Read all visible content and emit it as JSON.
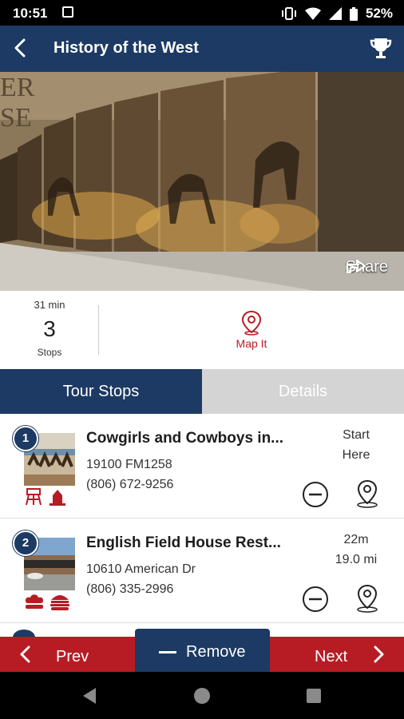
{
  "status_bar": {
    "time": "10:51",
    "battery": "52%"
  },
  "app_bar": {
    "title": "History of the West"
  },
  "hero": {
    "share_label": "Share"
  },
  "summary": {
    "duration": "31 min",
    "stop_count": "3",
    "stops_label": "Stops",
    "map_label": "Map It"
  },
  "tabs": [
    {
      "label": "Tour Stops"
    },
    {
      "label": "Details"
    }
  ],
  "stops": [
    {
      "number": "1",
      "name": "Cowgirls and Cowboys in...",
      "address": "19100 FM1258",
      "phone": "(806) 672-9256",
      "distance_line1": "Start",
      "distance_line2": "Here"
    },
    {
      "number": "2",
      "name": "English Field House Rest...",
      "address": "10610 American Dr",
      "phone": "(806) 335-2996",
      "distance_line1": "22m",
      "distance_line2": "19.0 mi"
    }
  ],
  "bottom_bar": {
    "prev_label": "Prev",
    "remove_label": "Remove",
    "next_label": "Next"
  },
  "colors": {
    "navy": "#1c3a63",
    "red": "#b71c24",
    "inactive_tab": "#d4d4d4"
  }
}
